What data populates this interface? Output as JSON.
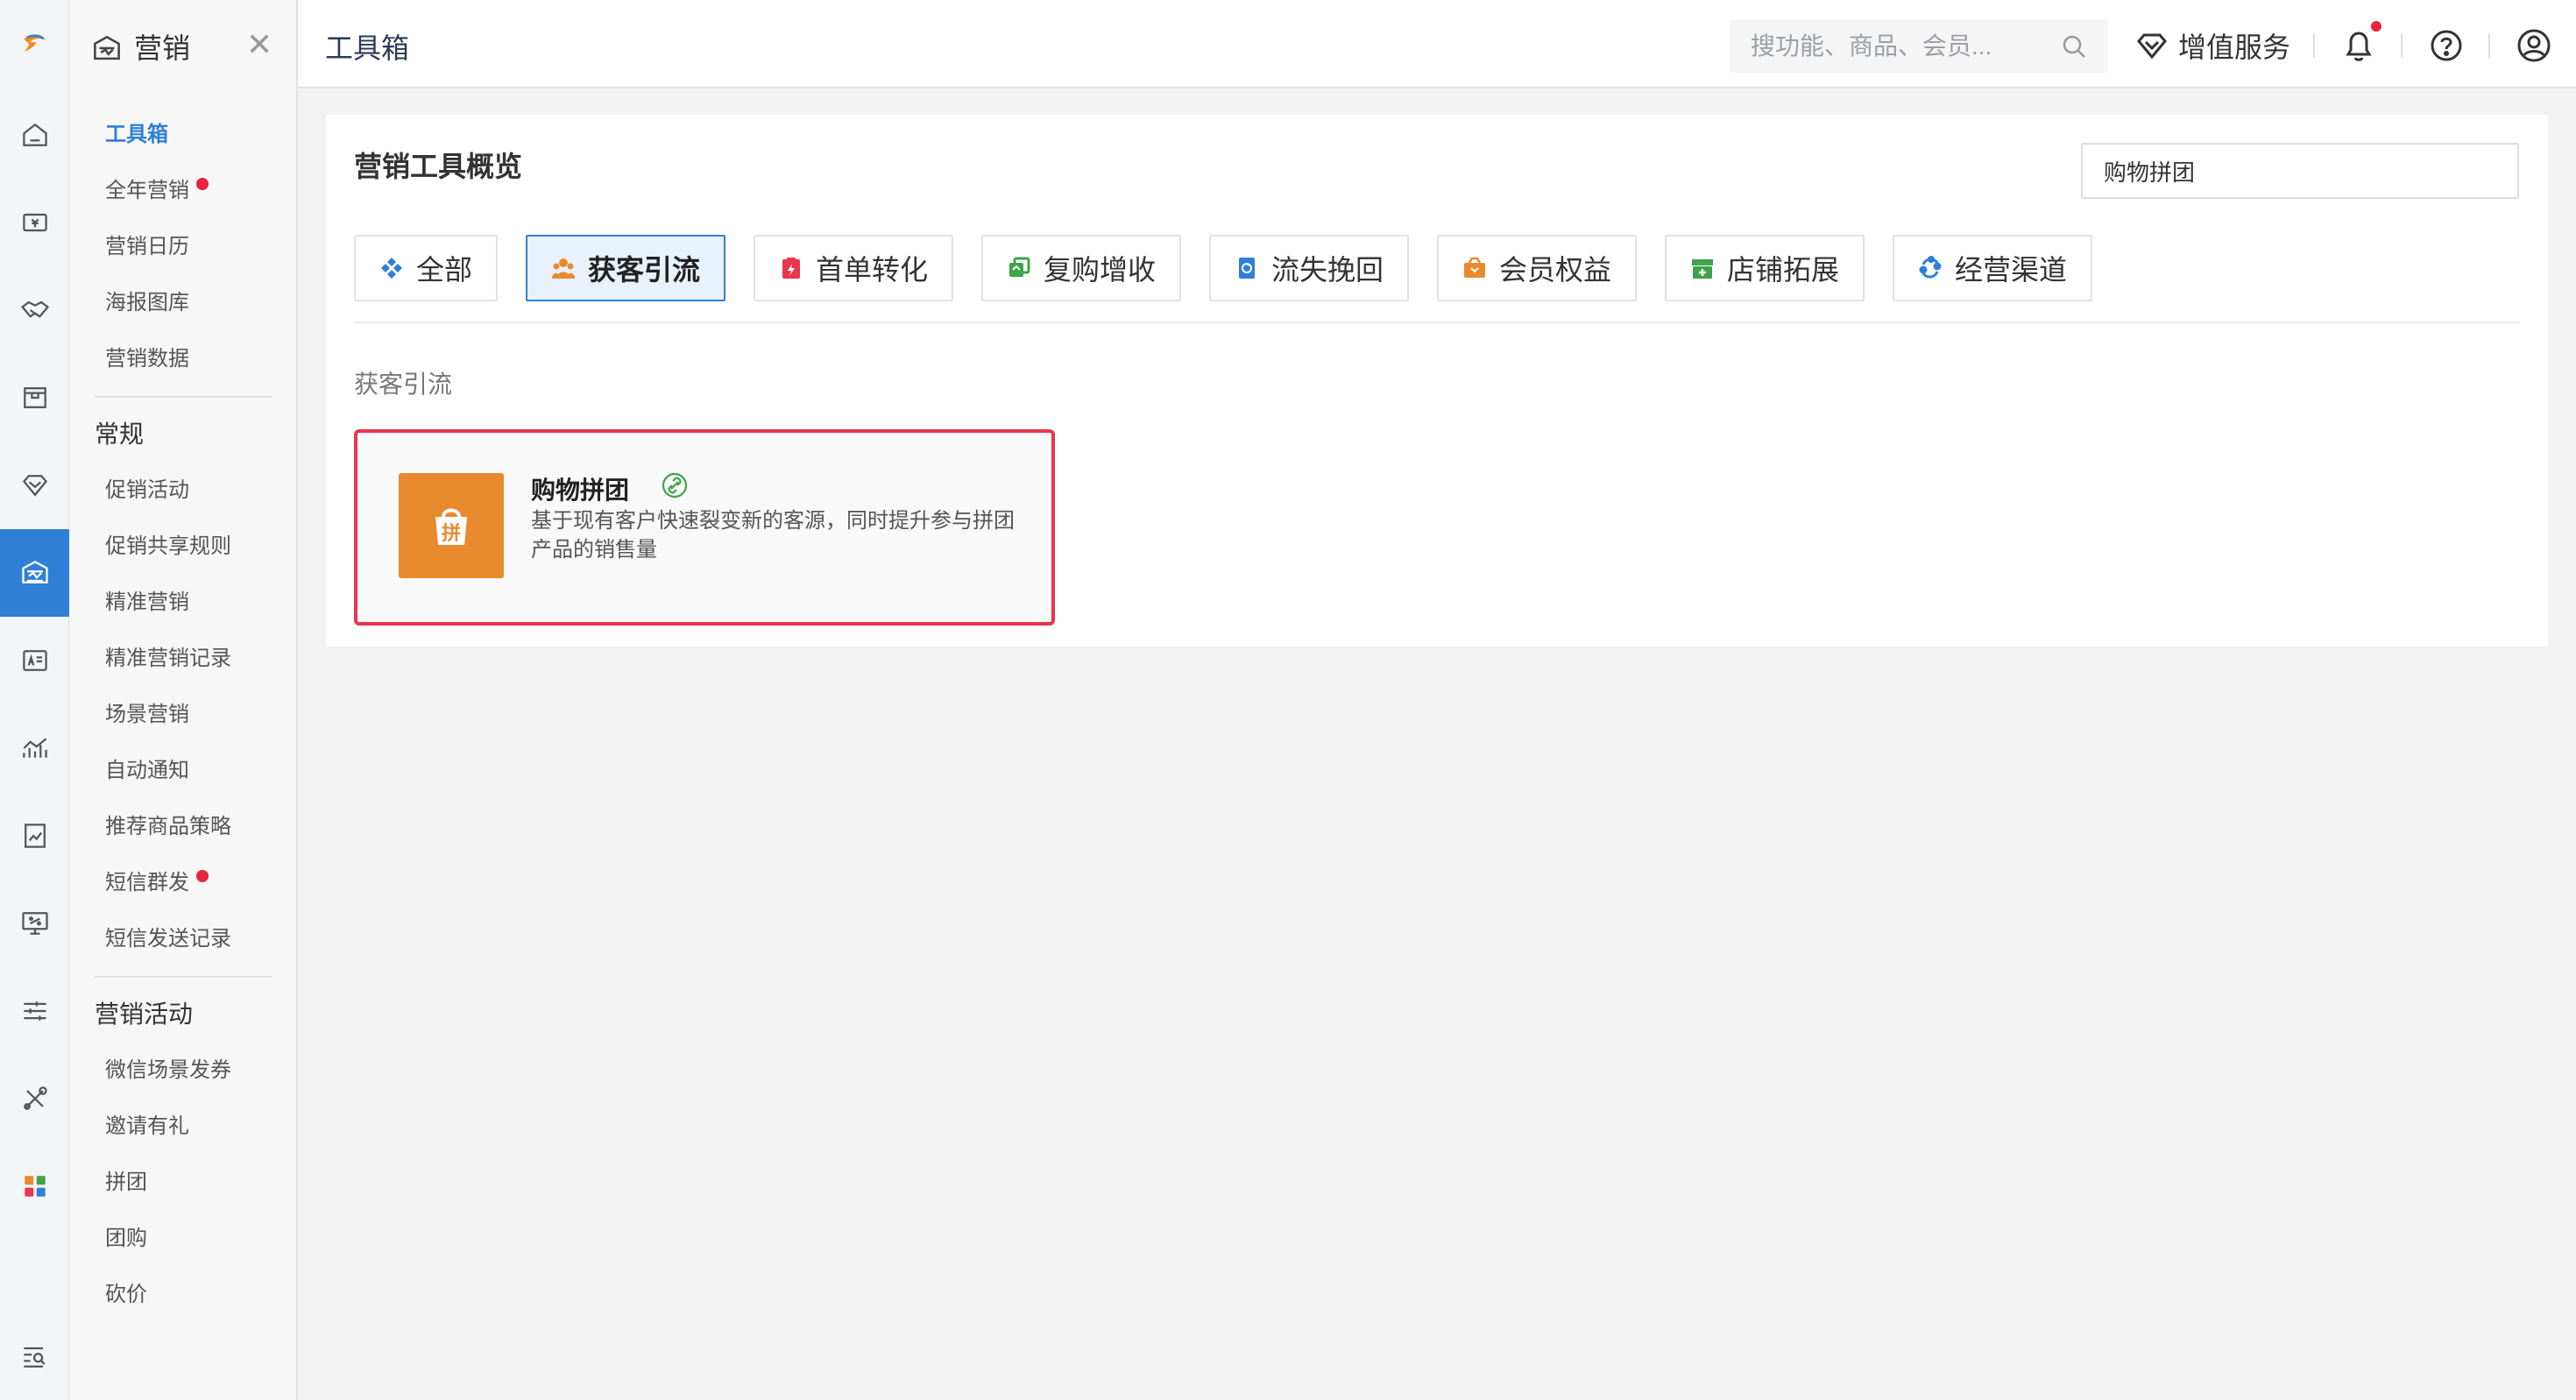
{
  "app": {
    "section_title": "营销"
  },
  "rail": {
    "icons": [
      "logo-icon",
      "home-icon",
      "cashier-icon",
      "handshake-icon",
      "box-icon",
      "diamond-icon",
      "marketing-icon",
      "member-card-icon",
      "chart-icon",
      "report-icon",
      "monitor-icon",
      "settings-sliders-icon",
      "tools-icon",
      "apps-grid-icon",
      "search-list-icon"
    ],
    "active": "marketing-icon"
  },
  "sidebar": {
    "title": "营销",
    "top_items": [
      {
        "label": "工具箱",
        "active": true
      },
      {
        "label": "全年营销",
        "dot": true
      },
      {
        "label": "营销日历"
      },
      {
        "label": "海报图库"
      },
      {
        "label": "营销数据"
      }
    ],
    "groups": [
      {
        "title": "常规",
        "items": [
          {
            "label": "促销活动"
          },
          {
            "label": "促销共享规则"
          },
          {
            "label": "精准营销"
          },
          {
            "label": "精准营销记录"
          },
          {
            "label": "场景营销"
          },
          {
            "label": "自动通知"
          },
          {
            "label": "推荐商品策略"
          },
          {
            "label": "短信群发",
            "dot": true
          },
          {
            "label": "短信发送记录"
          }
        ]
      },
      {
        "title": "营销活动",
        "items": [
          {
            "label": "微信场景发券"
          },
          {
            "label": "邀请有礼"
          },
          {
            "label": "拼团"
          },
          {
            "label": "团购"
          },
          {
            "label": "砍价"
          }
        ]
      }
    ]
  },
  "topbar": {
    "page_title": "工具箱",
    "search_placeholder": "搜功能、商品、会员...",
    "value_added_label": "增值服务",
    "notification_unread": true
  },
  "main": {
    "overview_title": "营销工具概览",
    "filter_value": "购物拼团",
    "tabs": [
      {
        "label": "全部",
        "icon": "diamond-grid-icon",
        "color": "#2f80d6"
      },
      {
        "label": "获客引流",
        "icon": "people-icon",
        "color": "#e98a2f",
        "active": true
      },
      {
        "label": "首单转化",
        "icon": "clipboard-bolt-icon",
        "color": "#e8364d"
      },
      {
        "label": "复购增收",
        "icon": "copy-refresh-icon",
        "color": "#3fa44a"
      },
      {
        "label": "流失挽回",
        "icon": "phone-return-icon",
        "color": "#2f80d6"
      },
      {
        "label": "会员权益",
        "icon": "wallet-icon",
        "color": "#e98a2f"
      },
      {
        "label": "店铺拓展",
        "icon": "store-add-icon",
        "color": "#3fa44a"
      },
      {
        "label": "经营渠道",
        "icon": "cycle-icon",
        "color": "#2f80d6"
      }
    ],
    "section_label": "获客引流",
    "tools": [
      {
        "name": "购物拼团",
        "icon_text": "拼",
        "description": "基于现有客户快速裂变新的客源，同时提升参与拼团产品的销售量"
      }
    ]
  },
  "colors": {
    "accent": "#2f80d6",
    "alert": "#e8233a",
    "card_border": "#e8364d",
    "tool_icon_bg": "#e98a2f"
  }
}
